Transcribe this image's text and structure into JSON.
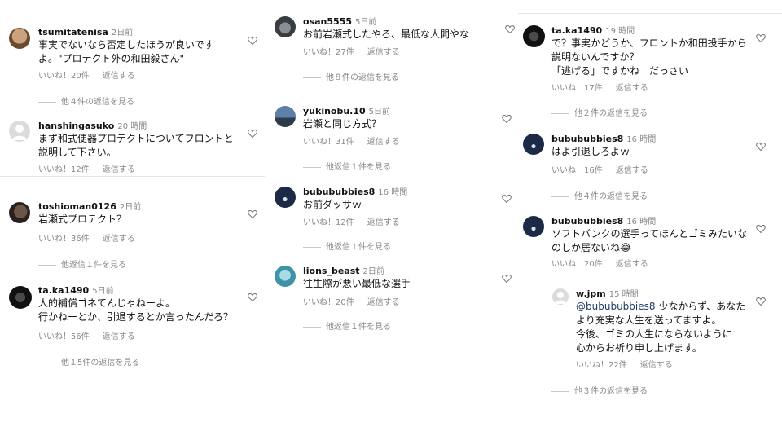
{
  "col1": {
    "c1": {
      "username": "tsumitatenisa",
      "time": "2日前",
      "text": "事実でないなら否定したほうが良いです\nよ。\"プロテクト外の和田毅さん\"",
      "likes": "いいね！20件",
      "reply": "返信する",
      "more": "他４件の返信を見る"
    },
    "c2": {
      "username": "hanshingasuko",
      "time": "20 時間",
      "text": "まず和式便器プロテクトについてフロントと\n説明して下さい。",
      "likes": "いいね！12件",
      "reply": "返信する"
    },
    "c3": {
      "username": "toshioman0126",
      "time": "2日前",
      "text": "岩瀬式プロテクト？",
      "likes": "いいね！36件",
      "reply": "返信する",
      "more": "他返信１件を見る"
    },
    "c4": {
      "username": "ta.ka1490",
      "time": "5日前",
      "text": "人的補償ゴネてんじゃねーよ。\n行かねーとか、引退するとか言ったんだろ？",
      "likes": "いいね！56件",
      "reply": "返信する",
      "more": "他１5件の返信を見る"
    }
  },
  "col2": {
    "c1": {
      "username": "osan5555",
      "time": "5日前",
      "text": "お前岩瀬式したやろ、最低な人間やな",
      "likes": "いいね！27件",
      "reply": "返信する",
      "more": "他８件の返信を見る"
    },
    "c2": {
      "username": "yukinobu.10",
      "time": "5日前",
      "text": "岩瀬と同じ方式？",
      "likes": "いいね！31件",
      "reply": "返信する",
      "more": "他返信１件を見る"
    },
    "c3": {
      "username": "bubububbies8",
      "time": "16 時間",
      "text": "お前ダッサｗ",
      "likes": "いいね！12件",
      "reply": "返信する",
      "more": "他返信１件を見る"
    },
    "c4": {
      "username": "lions_beast",
      "time": "2日前",
      "text": "往生際が悪い最低な選手",
      "likes": "いいね！20件",
      "reply": "返信する",
      "more": "他返信１件を見る"
    }
  },
  "col3": {
    "c1": {
      "username": "ta.ka1490",
      "time": "19 時間",
      "text": "で？事実かどうか、フロントか和田投手から\n説明ないんですか？\n「逃げる」ですかね　だっさい",
      "likes": "いいね！17件",
      "reply": "返信する",
      "more": "他２件の返信を見る"
    },
    "c2": {
      "username": "bubububbies8",
      "time": "16 時間",
      "text": "はよ引退しろよｗ",
      "likes": "いいね！16件",
      "reply": "返信する",
      "more": "他４件の返信を見る"
    },
    "c3": {
      "username": "bubububbies8",
      "time": "16 時間",
      "text": "ソフトバンクの選手ってほんとゴミみたいな\nのしか居ないね😂",
      "likes": "いいね！20件",
      "reply": "返信する"
    },
    "c4": {
      "username": "w.jpm",
      "time": "15 時間",
      "mention": "@bubububbies8",
      "text_after_mention": " 少なからず、あなた\nより充実な人生を送ってますよ。\n今後、ゴミの人生にならないように\n心からお祈り申し上げます。",
      "likes": "いいね！22件",
      "reply": "返信する",
      "more": "他３件の返信を見る"
    }
  }
}
